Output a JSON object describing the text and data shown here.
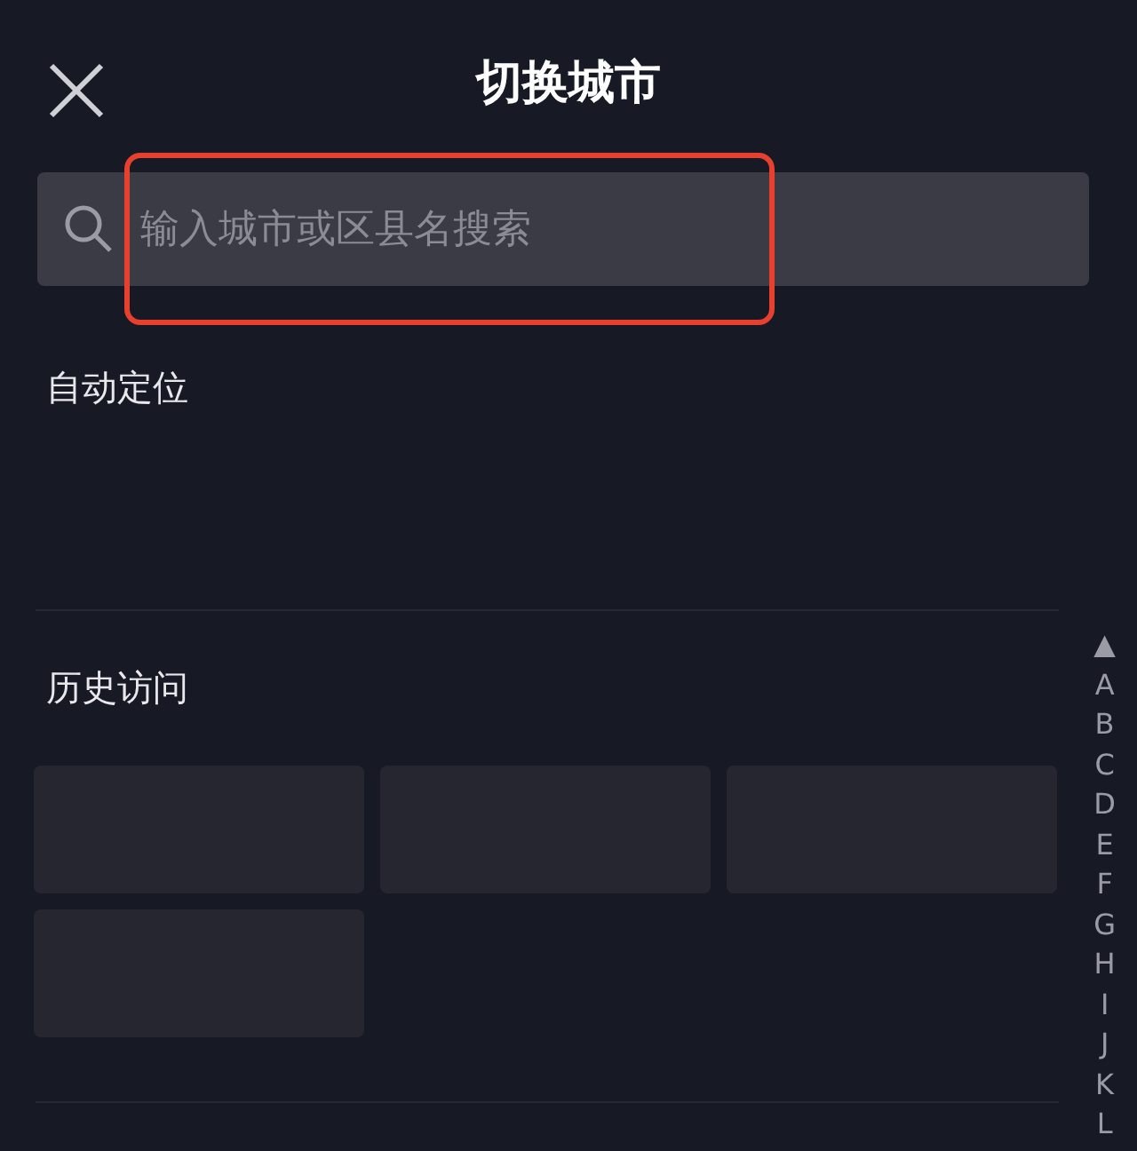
{
  "header": {
    "title": "切换城市"
  },
  "search": {
    "placeholder": "输入城市或区县名搜索",
    "highlighted": true
  },
  "auto_location": {
    "title": "自动定位"
  },
  "history": {
    "title": "历史访问",
    "cities": [
      {
        "kind": "city-chip"
      },
      {
        "kind": "city-chip"
      },
      {
        "kind": "city-chip"
      },
      {
        "kind": "city-chip"
      }
    ]
  },
  "index": [
    "▲",
    "A",
    "B",
    "C",
    "D",
    "E",
    "F",
    "G",
    "H",
    "I",
    "J",
    "K",
    "L"
  ]
}
